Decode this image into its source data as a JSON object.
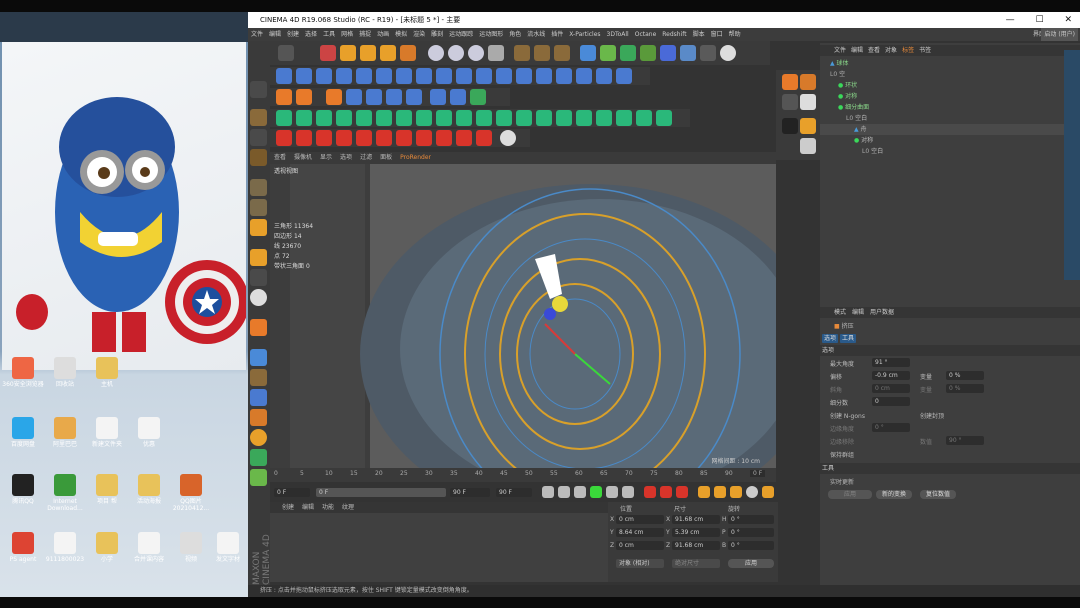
{
  "window": {
    "title": "CINEMA 4D R19.068 Studio (RC - R19) - [未标题 5 *] - 主要",
    "controls": [
      "—",
      "☐",
      "✕"
    ]
  },
  "menubar": [
    "文件",
    "编辑",
    "创建",
    "选择",
    "工具",
    "网格",
    "捕捉",
    "动画",
    "模拟",
    "渲染",
    "雕刻",
    "运动跟踪",
    "运动图形",
    "角色",
    "流水线",
    "插件",
    "X-Particles",
    "3DToAll",
    "Octane",
    "Redshift",
    "脚本",
    "窗口",
    "帮助"
  ],
  "layout_label": "界面:",
  "layout_value": "启动 (用户)",
  "viewport": {
    "menu": [
      "查看",
      "摄像机",
      "显示",
      "选项",
      "过滤",
      "面板",
      "ProRender"
    ],
    "label": "透视视图",
    "stats": [
      {
        "k": "三角形",
        "v": "11364"
      },
      {
        "k": "四边形",
        "v": "14"
      },
      {
        "k": "线",
        "v": "23670"
      },
      {
        "k": "点",
        "v": "72"
      },
      {
        "k": "带状三角面",
        "v": "0"
      }
    ],
    "grid": "网格间距 : 10 cm"
  },
  "timeline": {
    "ticks": [
      "0",
      "5",
      "10",
      "15",
      "20",
      "25",
      "30",
      "35",
      "40",
      "45",
      "50",
      "55",
      "60",
      "65",
      "70",
      "75",
      "80",
      "85",
      "90"
    ],
    "frame_end": "0 F",
    "start": "0 F",
    "cur": "0 F",
    "end": "90 F",
    "end2": "90 F"
  },
  "material": {
    "menu": [
      "创建",
      "编辑",
      "功能",
      "纹理"
    ]
  },
  "coords": {
    "headers": [
      "位置",
      "尺寸",
      "旋转"
    ],
    "rows": [
      {
        "a": "X",
        "p": "0 cm",
        "s": "91.68 cm",
        "r": "H",
        "rv": "0 °"
      },
      {
        "a": "Y",
        "p": "8.64 cm",
        "s": "5.39 cm",
        "r": "P",
        "rv": "0 °"
      },
      {
        "a": "Z",
        "p": "0 cm",
        "s": "91.68 cm",
        "r": "B",
        "rv": "0 °"
      }
    ],
    "mode": "对象 (相对)",
    "size_mode": "绝对尺寸",
    "apply": "应用"
  },
  "status": "挤压 : 点击并拖动鼠标挤压选取元素，按住 SHIFT 键锁定量模式改变倒角角度。",
  "objmgr": {
    "menu": [
      "文件",
      "编辑",
      "查看",
      "对象",
      "标签",
      "书签"
    ],
    "items": [
      {
        "name": "球体",
        "indent": 0
      },
      {
        "name": "空",
        "indent": 0
      },
      {
        "name": "环状",
        "indent": 1
      },
      {
        "name": "对称",
        "indent": 1
      },
      {
        "name": "细分曲面",
        "indent": 1
      },
      {
        "name": "空白",
        "indent": 2
      },
      {
        "name": "舟",
        "indent": 3
      },
      {
        "name": "对称",
        "indent": 3
      },
      {
        "name": "空白",
        "indent": 4
      }
    ]
  },
  "attr": {
    "menu": [
      "模式",
      "编辑",
      "用户数据"
    ],
    "tool": "挤压",
    "tabs": [
      "选项",
      "工具"
    ],
    "section": "选项",
    "fields": [
      {
        "k": "最大角度",
        "v": "91 °"
      },
      {
        "k": "偏移",
        "v": "-0.9 cm"
      },
      {
        "k": "斜角",
        "v": "0 cm"
      },
      {
        "k": "细分数",
        "v": "0"
      }
    ],
    "right": [
      {
        "k": "变量",
        "v": "0 %"
      },
      {
        "k": "变量",
        "v": "0 %"
      }
    ],
    "checks": [
      {
        "k": "创建 N-gons"
      },
      {
        "k": "边缘角度",
        "v": "0 °"
      },
      {
        "k": "边缘移除"
      },
      {
        "k": "保持群组"
      }
    ],
    "check_right": [
      {
        "k": "创建封顶"
      },
      {
        "k": "数值",
        "v": "90 °"
      }
    ],
    "tool_section": "工具",
    "realtime": "实时更新",
    "buttons": [
      "应用",
      "新的变换",
      "复位数值"
    ]
  },
  "desktop": {
    "icons": [
      "360安全浏览器",
      "回收站",
      "主机",
      "百度网盘",
      "阿里巴巴",
      "新建文件夹",
      "优惠",
      "腾讯QQ",
      "Internet Download...",
      "项目 帮",
      "活动海报",
      "QQ图片20210412...",
      "PS agent",
      "9111800023",
      "小学",
      "合并课内容",
      "视频",
      "发文字材"
    ]
  }
}
